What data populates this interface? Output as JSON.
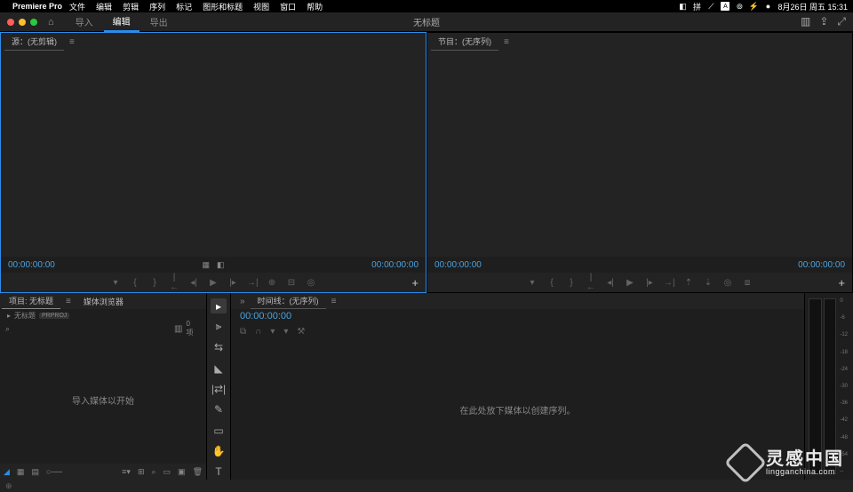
{
  "mac": {
    "app": "Premiere Pro",
    "menus": [
      "文件",
      "编辑",
      "剪辑",
      "序列",
      "标记",
      "图形和标题",
      "视图",
      "窗口",
      "帮助"
    ],
    "datetime": "8月26日 周五 15:31"
  },
  "header": {
    "tabs": [
      "导入",
      "编辑",
      "导出"
    ],
    "active_tab": 1,
    "project_title": "无标题"
  },
  "source_monitor": {
    "tab_label": "源：(无剪辑)",
    "tc_left": "00:00:00:00",
    "tc_right": "00:00:00:00"
  },
  "program_monitor": {
    "tab_label": "节目：(无序列)",
    "tc_left": "00:00:00:00",
    "tc_right": "00:00:00:00"
  },
  "project_panel": {
    "tabs": [
      "项目: 无标题",
      "媒体浏览器"
    ],
    "sub_label": "无标题",
    "sub_chip": "PRPROJ",
    "count": "0 项",
    "body_hint": "导入媒体以开始"
  },
  "timeline": {
    "tab_label": "时间线：(无序列)",
    "tc": "00:00:00:00",
    "body_hint": "在此处放下媒体以创建序列。"
  },
  "meter_scale": [
    "0",
    "-6",
    "-12",
    "-18",
    "-24",
    "-30",
    "-36",
    "-42",
    "-48",
    "-54",
    "--"
  ],
  "watermark": {
    "cn": "灵感中国",
    "en": "lingganchina.com"
  }
}
